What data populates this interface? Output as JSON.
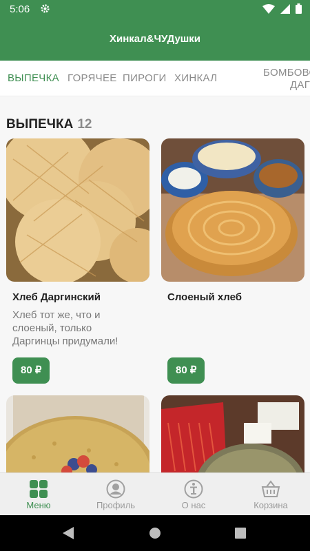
{
  "status_bar": {
    "time": "5:06"
  },
  "app_bar": {
    "title": "Хинкал&ЧУДушки"
  },
  "tabs": [
    {
      "label": "ВЫПЕЧКА"
    },
    {
      "label": "ГОРЯЧЕЕ"
    },
    {
      "label": "ПИРОГИ"
    },
    {
      "label": "ХИНКАЛ"
    },
    {
      "label_line1": "БОМБОВО",
      "label_line2": "ДАГЕ"
    }
  ],
  "section": {
    "title": "ВЫПЕЧКА",
    "count": "12"
  },
  "products": [
    {
      "name": "Хлеб Даргинский",
      "description": "Хлеб тот же, что и слоеный, только Даргинцы придумали!",
      "price": "80 ₽"
    },
    {
      "name": "Слоеный хлеб",
      "description": "",
      "price": "80 ₽"
    }
  ],
  "bottom_nav": [
    {
      "label": "Меню",
      "icon": "grid-icon"
    },
    {
      "label": "Профиль",
      "icon": "profile-icon"
    },
    {
      "label": "О нас",
      "icon": "info-icon"
    },
    {
      "label": "Корзина",
      "icon": "basket-icon"
    }
  ],
  "colors": {
    "primary": "#3f8f52",
    "inactive": "#8a8a8a",
    "background": "#f7f7f7"
  }
}
